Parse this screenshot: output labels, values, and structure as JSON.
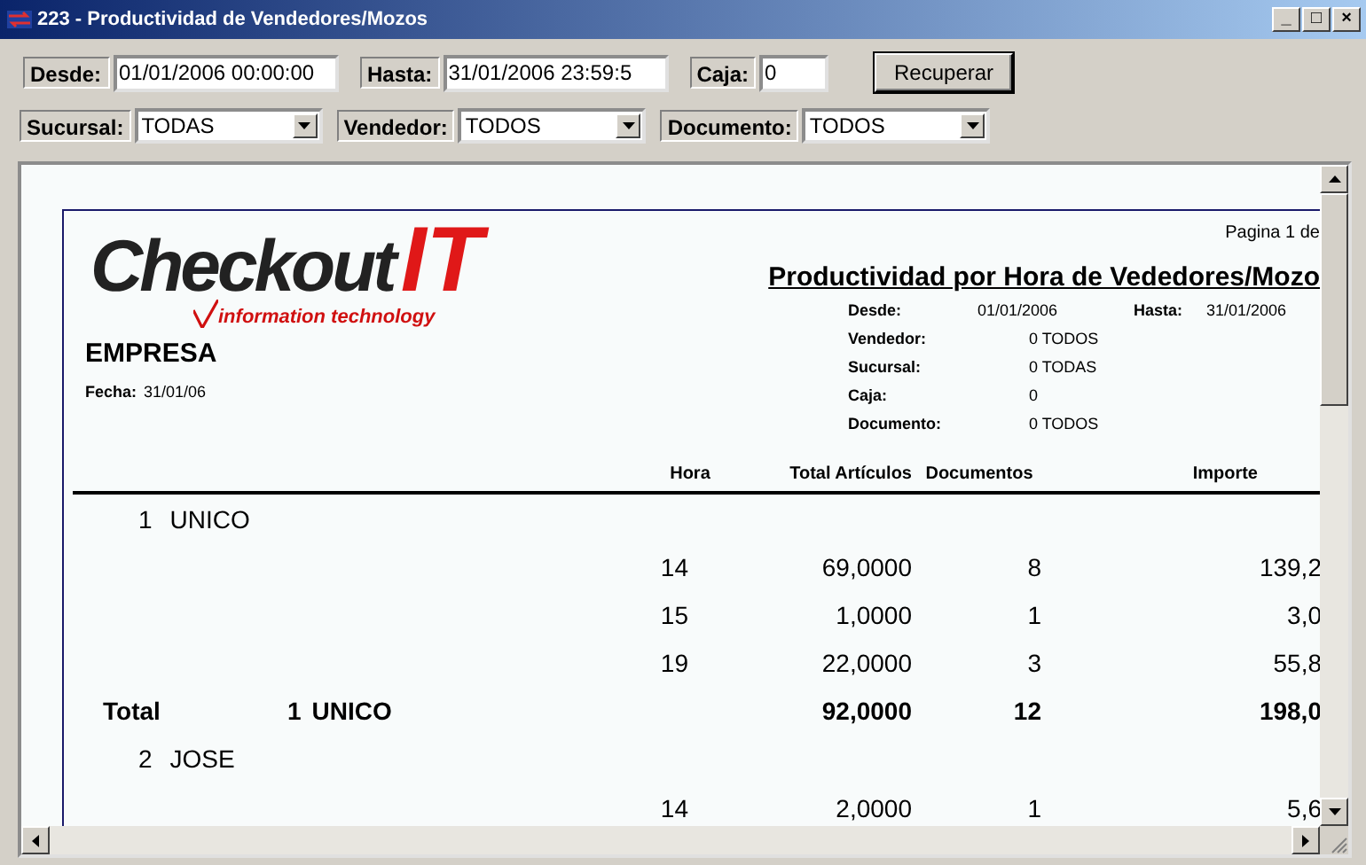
{
  "window": {
    "title": "223 - Productividad de Vendedores/Mozos",
    "controls": [
      "_",
      "□",
      "×"
    ]
  },
  "filters": [
    {
      "kind": "datetime",
      "label": "Desde:",
      "value": "01/01/2006 00:00:00"
    },
    {
      "kind": "datetime",
      "label": "Hasta:",
      "value": "31/01/2006 23:59:5"
    },
    {
      "kind": "number",
      "label": "Caja:",
      "value": "0"
    },
    {
      "kind": "button",
      "label": "Recuperar"
    },
    {
      "kind": "select",
      "label": "Sucursal:",
      "value": "TODAS"
    },
    {
      "kind": "select",
      "label": "Vendedor:",
      "value": "TODOS"
    },
    {
      "kind": "select",
      "label": "Documento:",
      "value": "TODOS"
    }
  ],
  "report": {
    "logo": {
      "name": "Checkout",
      "suffix": "IT",
      "tagline": "information technology"
    },
    "company": "EMPRESA",
    "date_label": "Fecha:",
    "date": "31/01/06",
    "page_label": "Pagina 1 de",
    "title": "Productividad por Hora de Vededores/Mozo",
    "params": [
      {
        "kind": "range",
        "label": "Desde:",
        "value": "01/01/2006",
        "extra_label": "Hasta:",
        "extra_value": "31/01/2006"
      },
      {
        "kind": "single",
        "label": "Vendedor:",
        "value": "0 TODOS"
      },
      {
        "kind": "single",
        "label": "Sucursal:",
        "value": "0 TODAS"
      },
      {
        "kind": "single",
        "label": "Caja:",
        "value": "0"
      },
      {
        "kind": "single",
        "label": "Documento:",
        "value": "0 TODOS"
      }
    ],
    "columns": [
      "Hora",
      "Total Artículos",
      "Documentos",
      "Importe"
    ],
    "groups": [
      {
        "number": "1",
        "name": "UNICO",
        "rows": [
          {
            "hora": "14",
            "total": "69,0000",
            "docs": "8",
            "importe": "139,2"
          },
          {
            "hora": "15",
            "total": "1,0000",
            "docs": "1",
            "importe": "3,0"
          },
          {
            "hora": "19",
            "total": "22,0000",
            "docs": "3",
            "importe": "55,8"
          }
        ],
        "total": {
          "label": "Total",
          "number": "1",
          "name": "UNICO",
          "total": "92,0000",
          "docs": "12",
          "importe": "198,0"
        }
      },
      {
        "number": "2",
        "name": "JOSE",
        "rows": [
          {
            "hora": "14",
            "total": "2,0000",
            "docs": "1",
            "importe": "5,6"
          }
        ]
      }
    ]
  }
}
